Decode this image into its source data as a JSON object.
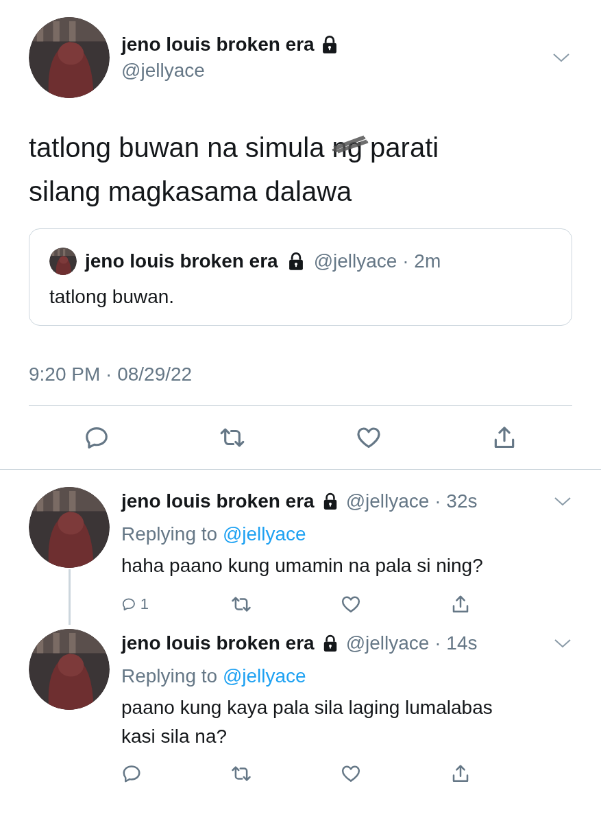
{
  "tweet": {
    "author": {
      "name": "jeno louis broken era",
      "handle": "@jellyace",
      "protected": true
    },
    "text": [
      {
        "text": "tatlong buwan na simula ",
        "scribbled": false
      },
      {
        "text": "ng",
        "scribbled": true
      },
      {
        "text": " parati silang magkasama dalawa",
        "scribbled": false
      }
    ],
    "quote": {
      "name": "jeno louis broken era",
      "protected": true,
      "handle": "@jellyace",
      "time": "· 2m",
      "text": "tatlong buwan."
    },
    "timestamp": "9:20 PM · 08/29/22",
    "actions": [
      {
        "kind": "reply"
      },
      {
        "kind": "retweet"
      },
      {
        "kind": "like"
      },
      {
        "kind": "share"
      }
    ]
  },
  "replies": [
    {
      "name": "jeno louis broken era",
      "protected": true,
      "handle": "@jellyace",
      "time": "· 32s",
      "replying_label": "Replying to",
      "replying_to": "@jellyace",
      "text": "haha paano kung umamin na pala si ning?",
      "thread_line": true,
      "actions": [
        {
          "kind": "reply",
          "count": "1"
        },
        {
          "kind": "retweet"
        },
        {
          "kind": "like"
        },
        {
          "kind": "share"
        }
      ]
    },
    {
      "name": "jeno louis broken era",
      "protected": true,
      "handle": "@jellyace",
      "time": "· 14s",
      "replying_label": "Replying to",
      "replying_to": "@jellyace",
      "text": "paano kung kaya pala sila laging lumalabas kasi sila na?",
      "thread_line": false,
      "actions": [
        {
          "kind": "reply"
        },
        {
          "kind": "retweet"
        },
        {
          "kind": "like"
        },
        {
          "kind": "share"
        }
      ]
    }
  ]
}
